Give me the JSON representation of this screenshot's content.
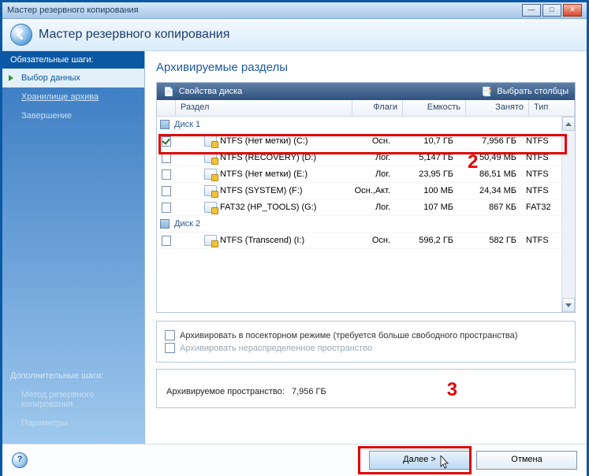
{
  "window": {
    "title": "Мастер резервного копирования",
    "wizard_title": "Мастер резервного копирования"
  },
  "sidebar": {
    "required_header": "Обязательные шаги:",
    "items": [
      "Выбор данных",
      "Хранилище архива",
      "Завершение"
    ],
    "optional_header": "Дополнительные шаги:",
    "optional_items": [
      "Метод резервного копирования",
      "Параметры"
    ]
  },
  "main": {
    "title": "Архивируемые разделы",
    "toolbar": {
      "disk_props": "Свойства диска",
      "choose_columns": "Выбрать столбцы"
    },
    "columns": {
      "partition": "Раздел",
      "flags": "Флаги",
      "capacity": "Емкость",
      "used": "Занято",
      "type": "Тип"
    },
    "disks": [
      {
        "label": "Диск 1",
        "partitions": [
          {
            "checked": true,
            "name": "NTFS (Нет метки) (C:)",
            "flags": "Осн.",
            "capacity": "10,7 ГБ",
            "used": "7,956 ГБ",
            "type": "NTFS"
          },
          {
            "checked": false,
            "name": "NTFS (RECOVERY) (D:)",
            "flags": "Лог.",
            "capacity": "5,147 ГБ",
            "used": "50,49 МБ",
            "type": "NTFS"
          },
          {
            "checked": false,
            "name": "NTFS (Нет метки) (E:)",
            "flags": "Лог.",
            "capacity": "23,95 ГБ",
            "used": "86,51 МБ",
            "type": "NTFS"
          },
          {
            "checked": false,
            "name": "NTFS (SYSTEM) (F:)",
            "flags": "Осн.,Акт.",
            "capacity": "100 МБ",
            "used": "24,34 МБ",
            "type": "NTFS"
          },
          {
            "checked": false,
            "name": "FAT32 (HP_TOOLS) (G:)",
            "flags": "Лог.",
            "capacity": "107 МБ",
            "used": "867 КБ",
            "type": "FAT32"
          }
        ]
      },
      {
        "label": "Диск 2",
        "partitions": [
          {
            "checked": false,
            "name": "NTFS (Transcend) (I:)",
            "flags": "Осн.",
            "capacity": "596,2 ГБ",
            "used": "582 ГБ",
            "type": "NTFS"
          }
        ]
      }
    ],
    "options": {
      "sector_mode": "Архивировать в посекторном режиме (требуется больше свободного пространства)",
      "unallocated": "Архивировать нераспределенное пространство"
    },
    "summary": {
      "label": "Архивируемое пространство:",
      "value": "7,956 ГБ"
    }
  },
  "footer": {
    "next": "Далее >",
    "cancel": "Отмена"
  },
  "annotations": {
    "n2": "2",
    "n3": "3"
  }
}
